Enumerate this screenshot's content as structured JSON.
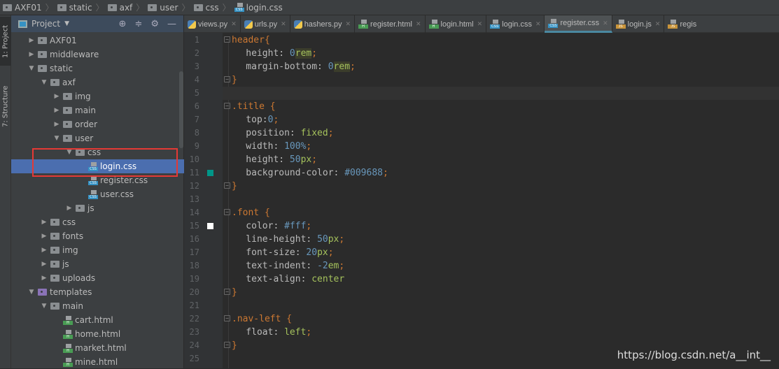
{
  "breadcrumb": [
    "AXF01",
    "static",
    "axf",
    "user",
    "css",
    "login.css"
  ],
  "sidebar_tabs": [
    "1: Project",
    "7: Structure"
  ],
  "project_panel": {
    "title": "Project",
    "tree": [
      {
        "label": "AXF01",
        "level": 0,
        "type": "folder",
        "expanded": false
      },
      {
        "label": "middleware",
        "level": 0,
        "type": "folder",
        "expanded": false
      },
      {
        "label": "static",
        "level": 0,
        "type": "folder",
        "expanded": true
      },
      {
        "label": "axf",
        "level": 1,
        "type": "folder",
        "expanded": true
      },
      {
        "label": "img",
        "level": 2,
        "type": "folder",
        "expanded": false
      },
      {
        "label": "main",
        "level": 2,
        "type": "folder",
        "expanded": false
      },
      {
        "label": "order",
        "level": 2,
        "type": "folder",
        "expanded": false
      },
      {
        "label": "user",
        "level": 2,
        "type": "folder",
        "expanded": true
      },
      {
        "label": "css",
        "level": 3,
        "type": "folder",
        "expanded": true
      },
      {
        "label": "login.css",
        "level": 4,
        "type": "css",
        "selected": true
      },
      {
        "label": "register.css",
        "level": 4,
        "type": "css"
      },
      {
        "label": "user.css",
        "level": 4,
        "type": "css"
      },
      {
        "label": "js",
        "level": 3,
        "type": "folder",
        "expanded": false
      },
      {
        "label": "css",
        "level": 1,
        "type": "folder",
        "expanded": false
      },
      {
        "label": "fonts",
        "level": 1,
        "type": "folder",
        "expanded": false
      },
      {
        "label": "img",
        "level": 1,
        "type": "folder",
        "expanded": false
      },
      {
        "label": "js",
        "level": 1,
        "type": "folder",
        "expanded": false
      },
      {
        "label": "uploads",
        "level": 1,
        "type": "folder",
        "expanded": false
      },
      {
        "label": "templates",
        "level": 0,
        "type": "folder-purple",
        "expanded": true
      },
      {
        "label": "main",
        "level": 1,
        "type": "folder",
        "expanded": true
      },
      {
        "label": "cart.html",
        "level": 2,
        "type": "html"
      },
      {
        "label": "home.html",
        "level": 2,
        "type": "html"
      },
      {
        "label": "market.html",
        "level": 2,
        "type": "html"
      },
      {
        "label": "mine.html",
        "level": 2,
        "type": "html"
      }
    ]
  },
  "tabs": [
    {
      "label": "views.py",
      "type": "py"
    },
    {
      "label": "urls.py",
      "type": "py"
    },
    {
      "label": "hashers.py",
      "type": "py"
    },
    {
      "label": "register.html",
      "type": "html"
    },
    {
      "label": "login.html",
      "type": "html"
    },
    {
      "label": "login.css",
      "type": "css"
    },
    {
      "label": "register.css",
      "type": "css",
      "active": true
    },
    {
      "label": "login.js",
      "type": "js"
    },
    {
      "label": "regis",
      "type": "js"
    }
  ],
  "code": [
    [
      [
        "header",
        "sel-t"
      ],
      [
        "{",
        "p"
      ]
    ],
    [
      [
        "    height: ",
        "prop"
      ],
      [
        "0",
        "num"
      ],
      [
        "rem",
        "unit hlu"
      ],
      [
        ";",
        "p"
      ]
    ],
    [
      [
        "    margin-bottom: ",
        "prop"
      ],
      [
        "0",
        "num"
      ],
      [
        "rem",
        "unit hlu"
      ],
      [
        ";",
        "p"
      ]
    ],
    [
      [
        "}",
        "p"
      ]
    ],
    [],
    [
      [
        ".title ",
        "sel-t"
      ],
      [
        "{",
        "p"
      ]
    ],
    [
      [
        "    top:",
        "prop"
      ],
      [
        "0",
        "num"
      ],
      [
        ";",
        "p"
      ]
    ],
    [
      [
        "    position: ",
        "prop"
      ],
      [
        "fixed",
        "kw"
      ],
      [
        ";",
        "p"
      ]
    ],
    [
      [
        "    width: ",
        "prop"
      ],
      [
        "100%",
        "num"
      ],
      [
        ";",
        "p"
      ]
    ],
    [
      [
        "    height: ",
        "prop"
      ],
      [
        "50",
        "num"
      ],
      [
        "px",
        "unit"
      ],
      [
        ";",
        "p"
      ]
    ],
    [
      [
        "    background-color: ",
        "prop"
      ],
      [
        "#009688",
        "col"
      ],
      [
        ";",
        "p"
      ]
    ],
    [
      [
        "}",
        "p"
      ]
    ],
    [],
    [
      [
        ".font ",
        "sel-t"
      ],
      [
        "{",
        "p"
      ]
    ],
    [
      [
        "    color: ",
        "prop"
      ],
      [
        "#fff",
        "col"
      ],
      [
        ";",
        "p"
      ]
    ],
    [
      [
        "    line-height: ",
        "prop"
      ],
      [
        "50",
        "num"
      ],
      [
        "px",
        "unit"
      ],
      [
        ";",
        "p"
      ]
    ],
    [
      [
        "    font-size: ",
        "prop"
      ],
      [
        "20",
        "num"
      ],
      [
        "px",
        "unit"
      ],
      [
        ";",
        "p"
      ]
    ],
    [
      [
        "    text-indent: ",
        "prop"
      ],
      [
        "-2",
        "num"
      ],
      [
        "em",
        "unit"
      ],
      [
        ";",
        "p"
      ]
    ],
    [
      [
        "    text-align: ",
        "prop"
      ],
      [
        "center",
        "kw"
      ]
    ],
    [
      [
        "}",
        "p"
      ]
    ],
    [],
    [
      [
        ".nav-left ",
        "sel-t"
      ],
      [
        "{",
        "p"
      ]
    ],
    [
      [
        "    float: ",
        "prop"
      ],
      [
        "left",
        "kw"
      ],
      [
        ";",
        "p"
      ]
    ],
    [
      [
        "}",
        "p"
      ]
    ],
    []
  ],
  "color_swatches": {
    "11": "#009688",
    "15": "#ffffff"
  },
  "watermark": "https://blog.csdn.net/a__int__"
}
